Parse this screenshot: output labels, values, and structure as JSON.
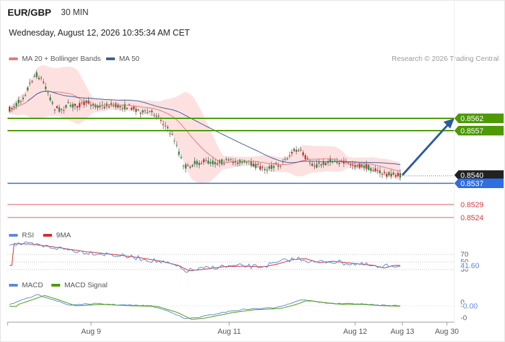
{
  "header": {
    "symbol": "EUR/GBP",
    "interval": "30 MIN",
    "datetime": "Wednesday, August 12, 2026 10:35:34 AM CET",
    "credit": "Research © 2026 Trading Central"
  },
  "legend": {
    "ma20_label": "MA 20 + Bollinger Bands",
    "ma50_label": "MA 50",
    "rsi_label": "RSI",
    "ma9_label": "9MA",
    "macd_label": "MACD",
    "macd_signal_label": "MACD Signal"
  },
  "colors": {
    "ma20": "#e87878",
    "ma50": "#3e5f92",
    "bollinger_fill": "#fde1e1",
    "resistance": "#4d9a06",
    "support_current": "#2f6de1",
    "support": "#e0595b",
    "price_tag": "#222222",
    "arrow": "#2c5aa0",
    "rsi": "#5b8ad8",
    "rsi_ma": "#d62b2b",
    "macd": "#5b8ad8",
    "macd_signal": "#4d9a06",
    "candle_up": "#2e8b3a",
    "candle_down": "#cf2a2a"
  },
  "price_levels": [
    {
      "label": "0.8562",
      "style": "resistance"
    },
    {
      "label": "0.8557",
      "style": "resistance"
    },
    {
      "label": "0.8540",
      "style": "current"
    },
    {
      "label": "0.8537",
      "style": "pivot"
    },
    {
      "label": "0.8529",
      "style": "support"
    },
    {
      "label": "0.8524",
      "style": "support"
    }
  ],
  "rsi_panel": {
    "levels": [
      "70",
      "50",
      "30"
    ],
    "value": "41.60"
  },
  "macd_panel": {
    "levels": [
      "0",
      "-0"
    ],
    "value": "-0.00"
  },
  "x_axis": {
    "ticks": [
      "Aug 9",
      "Aug 11",
      "Aug 12",
      "Aug 13",
      "Aug 30"
    ]
  }
}
